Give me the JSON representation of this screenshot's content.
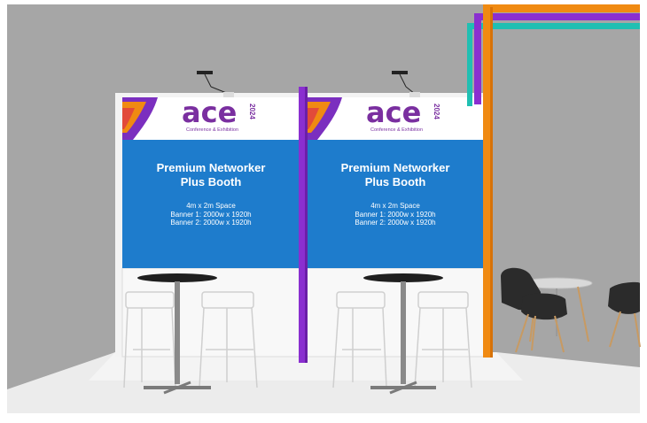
{
  "booths": [
    {
      "logo": {
        "wordmark": "ace",
        "year": "2024",
        "subtitle": "Conference & Exhibition"
      },
      "title_line1": "Premium Networker",
      "title_line2": "Plus Booth",
      "spec_line1": "4m x 2m Space",
      "spec_line2": "Banner 1: 2000w x 1920h",
      "spec_line3": "Banner 2: 2000w x 1920h"
    },
    {
      "logo": {
        "wordmark": "ace",
        "year": "2024",
        "subtitle": "Conference & Exhibition"
      },
      "title_line1": "Premium Networker",
      "title_line2": "Plus Booth",
      "spec_line1": "4m x 2m Space",
      "spec_line2": "Banner 1: 2000w x 1920h",
      "spec_line3": "Banner 2: 2000w x 1920h"
    }
  ],
  "colors": {
    "back_wall": "#a6a6a6",
    "floor": "#ececec",
    "banner_blue": "#1e7ccc",
    "purple": "#8a2fd0",
    "orange": "#f08a12",
    "teal": "#20bfb2",
    "chair_black": "#2b2b2b",
    "wood": "#c89a62"
  }
}
